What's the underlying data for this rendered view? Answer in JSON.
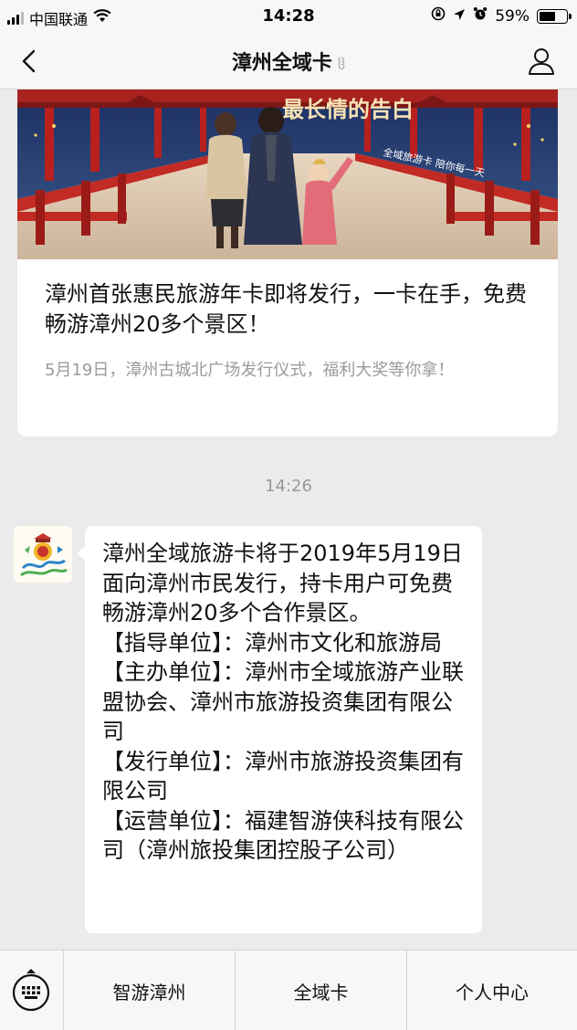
{
  "status_bar": {
    "carrier": "中国联通",
    "time": "14:28",
    "battery_pct": "59%",
    "battery_level": 0.59
  },
  "nav": {
    "title": "漳州全域卡"
  },
  "article": {
    "banner_text_1": "最长情的告白",
    "banner_text_2": "全域旅游卡 陪你每一天",
    "title": "漳州首张惠民旅游年卡即将发行，一卡在手，免费畅游漳州20多个景区！",
    "description": "5月19日，漳州古城北广场发行仪式，福利大奖等你拿！"
  },
  "timestamp": "14:26",
  "message": {
    "text": "漳州全域旅游卡将于2019年5月19日面向漳州市民发行，持卡用户可免费畅游漳州20多个合作景区。\n【指导单位】：漳州市文化和旅游局\n【主办单位】：漳州市全域旅游产业联盟协会、漳州市旅游投资集团有限公司\n【发行单位】：漳州市旅游投资集团有限公司\n【运营单位】：福建智游侠科技有限公司（漳州旅投集团控股子公司）"
  },
  "menu": {
    "items": [
      "智游漳州",
      "全域卡",
      "个人中心"
    ]
  },
  "colors": {
    "background": "#ebebeb",
    "bar": "#f7f7f7",
    "banner_red": "#b8201e"
  }
}
